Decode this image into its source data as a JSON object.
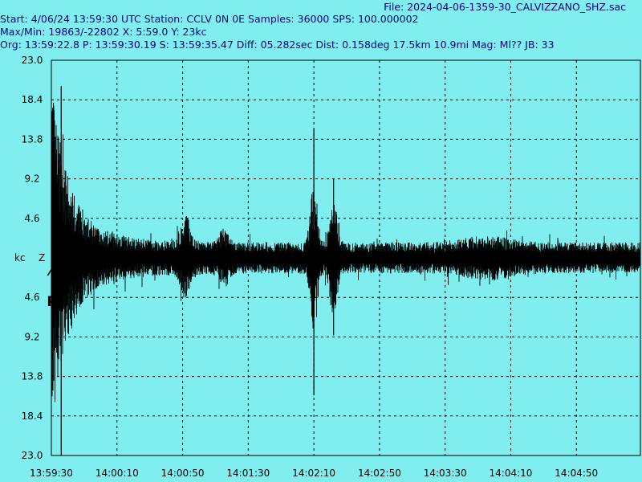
{
  "header": {
    "file": "File: 2024-04-06-1359-30_CALVIZZANO_SHZ.sac",
    "start": "Start: 4/06/24 13:59:30 UTC Station: CCLV 0N 0E Samples: 36000  SPS: 100.000002",
    "maxmin": "Max/Min: 19863/-22802 X: 5:59.0 Y: 23kc",
    "org": "Org: 13:59:22.8 P: 13:59:30.19 S: 13:59:35.47 Diff: 05.282sec Dist: 0.158deg 17.5km 10.9mi  Mag: Ml?? JB: 33"
  },
  "colors": {
    "background": "#80eeee",
    "header_text": "#000080",
    "trace": "#000000",
    "grid": "#000000"
  },
  "chart_data": {
    "type": "line",
    "ylabel": "kc",
    "component": "Z",
    "y_ticks": [
      "23.0",
      "18.4",
      "13.8",
      "9.2",
      "4.6",
      "4.6",
      "9.2",
      "13.8",
      "18.4",
      "23.0"
    ],
    "y_tick_values": [
      23.0,
      18.4,
      13.8,
      9.2,
      4.6,
      -4.6,
      -9.2,
      -13.8,
      -18.4,
      -23.0
    ],
    "ylim": [
      -23.0,
      23.0
    ],
    "x_ticks": [
      "13:59:30",
      "14:00:10",
      "14:00:50",
      "14:01:30",
      "14:02:10",
      "14:02:50",
      "14:03:30",
      "14:04:10",
      "14:04:50"
    ],
    "xlim": [
      "13:59:30",
      "14:05:29"
    ],
    "grid": true,
    "picks": {
      "p_label": "P",
      "s_label": "S",
      "p_time": "13:59:30.19",
      "s_time": "13:59:35.47"
    },
    "max": 19863,
    "min": -22802,
    "events": [
      {
        "time": "13:59:36",
        "peak_kc": 20.0,
        "trough_kc": -23.0
      },
      {
        "time": "14:02:10",
        "peak_kc": 15.0,
        "trough_kc": -16.0
      },
      {
        "time": "14:02:22",
        "peak_kc": 9.2,
        "trough_kc": -9.0
      }
    ]
  }
}
